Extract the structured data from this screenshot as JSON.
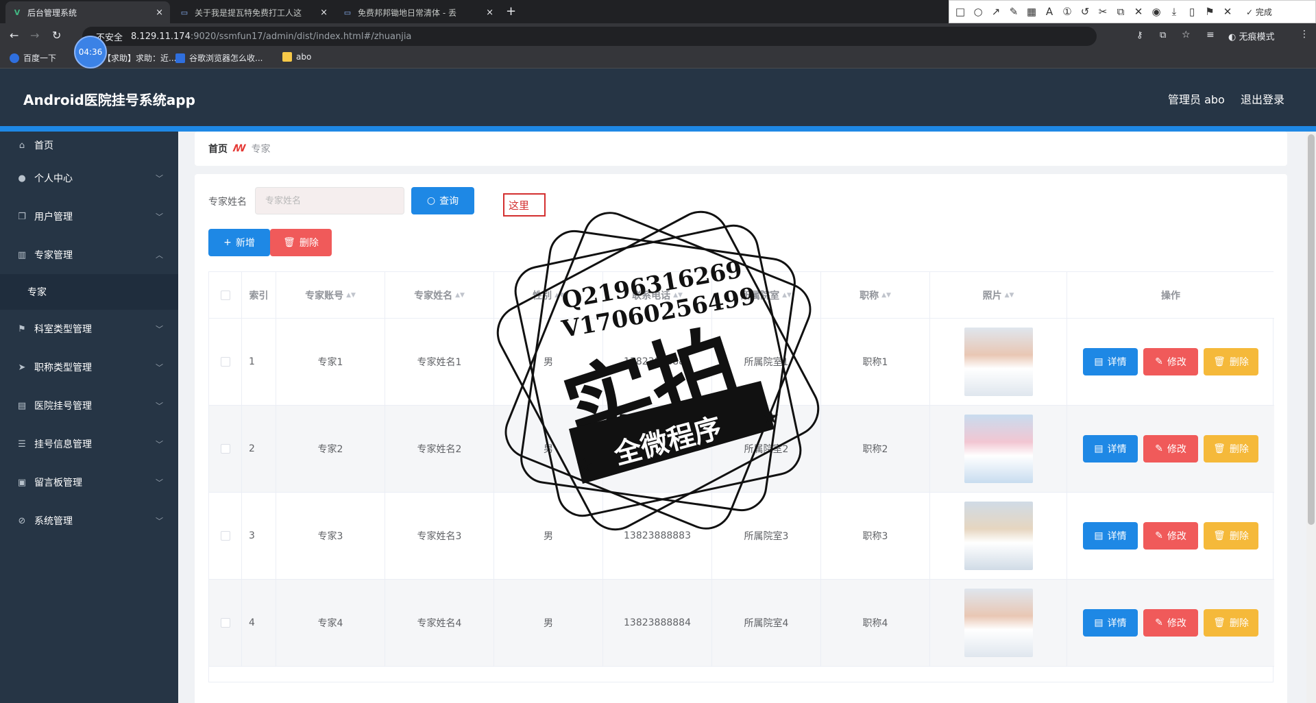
{
  "browser": {
    "tabs": [
      {
        "label": "后台管理系统",
        "active": true
      },
      {
        "label": "关于我是提瓦特免费打工人这"
      },
      {
        "label": "免费邦邦锄地日常清体 - 丢"
      }
    ],
    "new_tab": "+",
    "close": "×",
    "url_warning": "不安全",
    "url_host": "8.129.11.174",
    "url_path": ":9020/ssmfun17/admin/dist/index.html#/zhuanjia",
    "incognito": "无痕模式",
    "timer": "04:36",
    "bookmarks": [
      "百度一下",
      "【求助】求助：近...",
      "谷歌浏览器怎么收...",
      "abo"
    ]
  },
  "annotator": {
    "font_size": "12",
    "done": "完成",
    "palette": [
      "#000000",
      "#7f7f7f",
      "#880015",
      "#ed1c24",
      "#ff7f27",
      "#22b14c",
      "#00a2e8",
      "#3f48cc",
      "#a349a4",
      "#00c0c0",
      "#ffffff",
      "#c3c3c3",
      "#b97a57",
      "#ff3b3b",
      "#ffc90e",
      "#b5e61d",
      "#99d9ea",
      "#7092be",
      "#c8bfe7",
      "#22d8d8"
    ],
    "current_color": "#ff3333"
  },
  "app": {
    "title": "Android医院挂号系统app",
    "admin": "管理员 abo",
    "logout": "退出登录"
  },
  "sidebar": {
    "items": [
      {
        "label": "首页",
        "icon": "home-icon"
      },
      {
        "label": "个人中心",
        "icon": "user-icon"
      },
      {
        "label": "用户管理",
        "icon": "copy-icon"
      },
      {
        "label": "专家管理",
        "icon": "building-icon",
        "expanded": true
      },
      {
        "label": "专家",
        "sub": true
      },
      {
        "label": "科室类型管理",
        "icon": "flag-icon"
      },
      {
        "label": "职称类型管理",
        "icon": "send-icon"
      },
      {
        "label": "医院挂号管理",
        "icon": "suitcase-icon"
      },
      {
        "label": "挂号信息管理",
        "icon": "list-icon"
      },
      {
        "label": "留言板管理",
        "icon": "document-icon"
      },
      {
        "label": "系统管理",
        "icon": "compass-icon"
      }
    ]
  },
  "breadcrumb": {
    "home": "首页",
    "current": "专家"
  },
  "search": {
    "label": "专家姓名",
    "placeholder": "专家姓名",
    "button": "查询"
  },
  "actions": {
    "add": "新增",
    "delete": "删除"
  },
  "annotation_text": "这里",
  "table": {
    "headers": [
      "索引",
      "专家账号",
      "专家姓名",
      "性别",
      "联系电话",
      "所属院室",
      "职称",
      "照片",
      "操作"
    ],
    "rows": [
      {
        "index": "1",
        "account": "专家1",
        "name": "专家姓名1",
        "gender": "男",
        "phone": "13823888881",
        "dept": "所属院室1",
        "title": "职称1"
      },
      {
        "index": "2",
        "account": "专家2",
        "name": "专家姓名2",
        "gender": "男",
        "phone": "13823888882",
        "dept": "所属院室2",
        "title": "职称2"
      },
      {
        "index": "3",
        "account": "专家3",
        "name": "专家姓名3",
        "gender": "男",
        "phone": "13823888883",
        "dept": "所属院室3",
        "title": "职称3"
      },
      {
        "index": "4",
        "account": "专家4",
        "name": "专家姓名4",
        "gender": "男",
        "phone": "13823888884",
        "dept": "所属院室4",
        "title": "职称4"
      }
    ],
    "row_actions": {
      "detail": "详情",
      "edit": "修改",
      "delete": "删除"
    }
  },
  "watermark": {
    "line1": "Q2196316269",
    "line2": "V17060256499",
    "main": "实拍",
    "banner": "全微程序"
  }
}
